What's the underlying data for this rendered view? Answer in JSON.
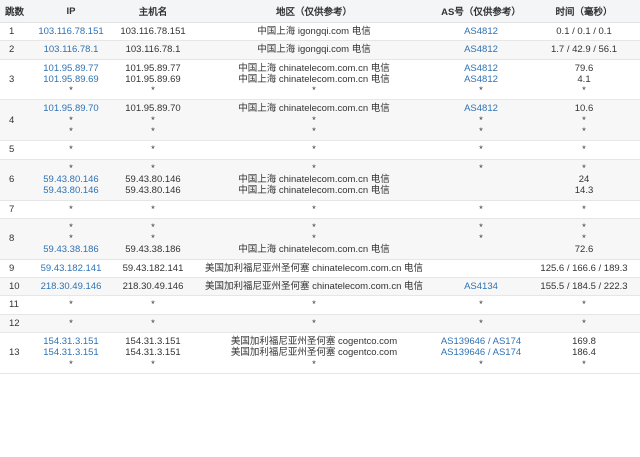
{
  "headers": {
    "hop": "跳数",
    "ip": "IP",
    "host": "主机名",
    "region": "地区（仅供参考）",
    "as": "AS号（仅供参考）",
    "time": "时间（毫秒）"
  },
  "rows": [
    {
      "hop": "1",
      "lines": [
        {
          "ip": "103.116.78.151",
          "host": "103.116.78.151",
          "region": "中国上海 igongqi.com 电信",
          "as": [
            "AS4812"
          ],
          "time": "0.1 / 0.1 / 0.1"
        }
      ]
    },
    {
      "hop": "2",
      "lines": [
        {
          "ip": "103.116.78.1",
          "host": "103.116.78.1",
          "region": "中国上海 igongqi.com 电信",
          "as": [
            "AS4812"
          ],
          "time": "1.7 / 42.9 / 56.1"
        }
      ]
    },
    {
      "hop": "3",
      "lines": [
        {
          "ip": "101.95.89.77",
          "host": "101.95.89.77",
          "region": "中国上海 chinatelecom.com.cn 电信",
          "as": [
            "AS4812"
          ],
          "time": "79.6"
        },
        {
          "ip": "101.95.89.69",
          "host": "101.95.89.69",
          "region": "中国上海 chinatelecom.com.cn 电信",
          "as": [
            "AS4812"
          ],
          "time": "4.1"
        },
        {
          "ip": "*",
          "host": "*",
          "region": "*",
          "as": [
            "*"
          ],
          "time": "*"
        }
      ]
    },
    {
      "hop": "4",
      "lines": [
        {
          "ip": "101.95.89.70",
          "host": "101.95.89.70",
          "region": "中国上海 chinatelecom.com.cn 电信",
          "as": [
            "AS4812"
          ],
          "time": "10.6"
        },
        {
          "ip": "*",
          "host": "*",
          "region": "*",
          "as": [
            "*"
          ],
          "time": "*"
        },
        {
          "ip": "*",
          "host": "*",
          "region": "*",
          "as": [
            "*"
          ],
          "time": "*"
        }
      ]
    },
    {
      "hop": "5",
      "lines": [
        {
          "ip": "*",
          "host": "*",
          "region": "*",
          "as": [
            "*"
          ],
          "time": "*"
        }
      ]
    },
    {
      "hop": "6",
      "lines": [
        {
          "ip": "*",
          "host": "*",
          "region": "*",
          "as": [
            "*"
          ],
          "time": "*"
        },
        {
          "ip": "59.43.80.146",
          "host": "59.43.80.146",
          "region": "中国上海 chinatelecom.com.cn 电信",
          "as": [],
          "time": "24"
        },
        {
          "ip": "59.43.80.146",
          "host": "59.43.80.146",
          "region": "中国上海 chinatelecom.com.cn 电信",
          "as": [],
          "time": "14.3"
        }
      ]
    },
    {
      "hop": "7",
      "lines": [
        {
          "ip": "*",
          "host": "*",
          "region": "*",
          "as": [
            "*"
          ],
          "time": "*"
        }
      ]
    },
    {
      "hop": "8",
      "lines": [
        {
          "ip": "*",
          "host": "*",
          "region": "*",
          "as": [
            "*"
          ],
          "time": "*"
        },
        {
          "ip": "*",
          "host": "*",
          "region": "*",
          "as": [
            "*"
          ],
          "time": "*"
        },
        {
          "ip": "59.43.38.186",
          "host": "59.43.38.186",
          "region": "中国上海 chinatelecom.com.cn 电信",
          "as": [],
          "time": "72.6"
        }
      ]
    },
    {
      "hop": "9",
      "lines": [
        {
          "ip": "59.43.182.141",
          "host": "59.43.182.141",
          "region": "美国加利福尼亚州圣何塞 chinatelecom.com.cn 电信",
          "as": [],
          "time": "125.6 / 166.6 / 189.3"
        }
      ]
    },
    {
      "hop": "10",
      "lines": [
        {
          "ip": "218.30.49.146",
          "host": "218.30.49.146",
          "region": "美国加利福尼亚州圣何塞 chinatelecom.com.cn 电信",
          "as": [
            "AS4134"
          ],
          "time": "155.5 / 184.5 / 222.3"
        }
      ]
    },
    {
      "hop": "11",
      "lines": [
        {
          "ip": "*",
          "host": "*",
          "region": "*",
          "as": [
            "*"
          ],
          "time": "*"
        }
      ]
    },
    {
      "hop": "12",
      "lines": [
        {
          "ip": "*",
          "host": "*",
          "region": "*",
          "as": [
            "*"
          ],
          "time": "*"
        }
      ]
    },
    {
      "hop": "13",
      "lines": [
        {
          "ip": "154.31.3.151",
          "host": "154.31.3.151",
          "region": "美国加利福尼亚州圣何塞 cogentco.com",
          "as": [
            "AS139646",
            "AS174"
          ],
          "time": "169.8"
        },
        {
          "ip": "154.31.3.151",
          "host": "154.31.3.151",
          "region": "美国加利福尼亚州圣何塞 cogentco.com",
          "as": [
            "AS139646",
            "AS174"
          ],
          "time": "186.4"
        },
        {
          "ip": "*",
          "host": "*",
          "region": "*",
          "as": [
            "*"
          ],
          "time": "*"
        }
      ]
    }
  ]
}
